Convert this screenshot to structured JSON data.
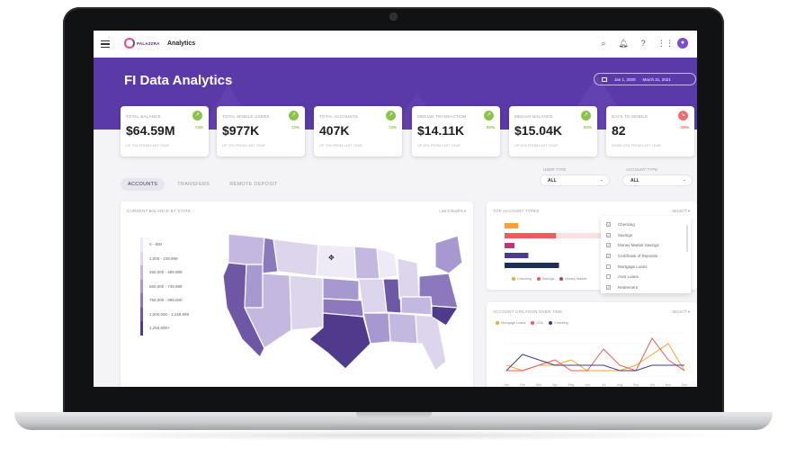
{
  "app": {
    "logo_text": "PALAZZRA",
    "title": "Analytics",
    "page_title": "FI Data Analytics",
    "date_start": "Jan 1, 2020",
    "date_end": "March 31, 2021"
  },
  "kpis": [
    {
      "label": "TOTAL BALANCE",
      "value": "$64.59M",
      "pct": "73%",
      "sub": "UP 73% FROM LAST YEAR",
      "trend": "up",
      "color": "#8bc34a"
    },
    {
      "label": "TOTAL MOBILE USERS",
      "value": "$977K",
      "pct": "72%",
      "sub": "UP 72% FROM LAST YEAR",
      "trend": "up",
      "color": "#8bc34a"
    },
    {
      "label": "TOTAL ACCOUNTS",
      "value": "407K",
      "pct": "72%",
      "sub": "UP 72% FROM LAST YEAR",
      "trend": "up",
      "color": "#8bc34a"
    },
    {
      "label": "MEDIAN TRANSACTION",
      "value": "$14.11K",
      "pct": "82%",
      "sub": "UP 82% FROM LAST YEAR",
      "trend": "up",
      "color": "#8bc34a"
    },
    {
      "label": "MEDIAN BALANCE",
      "value": "$15.04K",
      "pct": "92%",
      "sub": "UP 92% FROM LAST YEAR",
      "trend": "up",
      "color": "#8bc34a"
    },
    {
      "label": "DAYS TO MOBILE",
      "value": "82",
      "pct": "-25%",
      "sub": "DOWN 25% FROM LAST YEAR",
      "trend": "down",
      "color": "#f06b6b"
    }
  ],
  "tabs": [
    {
      "label": "ACCOUNTS",
      "active": true
    },
    {
      "label": "TRANSFERS",
      "active": false
    },
    {
      "label": "REMOTE DEPOSIT",
      "active": false
    }
  ],
  "filters": {
    "user_type_label": "USER TYPE",
    "user_type_value": "ALL",
    "account_type_label": "ACCOUNT TYPE",
    "account_type_value": "ALL"
  },
  "map_panel": {
    "title": "CURRENT BALANCE BY STATE",
    "action": "Last 6 Months",
    "legend": [
      {
        "label": "0 - 900",
        "color": "#eeeaf6"
      },
      {
        "label": "1,000 - 249,999",
        "color": "#dcd5ec"
      },
      {
        "label": "250,000 - 499,999",
        "color": "#c4b8e0"
      },
      {
        "label": "500,000 - 749,999",
        "color": "#a898d0"
      },
      {
        "label": "750,000 - 999,000",
        "color": "#8c79bd"
      },
      {
        "label": "1,000,000 - 1,249,999",
        "color": "#6e58a6"
      },
      {
        "label": "1,250,000+",
        "color": "#4f3a8c"
      }
    ]
  },
  "top_accounts_panel": {
    "title": "TOP ACCOUNT TYPES",
    "action": "SELECT",
    "bars": [
      {
        "name": "Checking",
        "value": 0.14,
        "color": "#f4a52a"
      },
      {
        "name": "Savings",
        "value": 0.52,
        "color": "#f05a5a"
      },
      {
        "name": "Money Market Savings",
        "value": 0.1,
        "color": "#c2357a"
      },
      {
        "name": "Certificate of Deposits",
        "value": 0.24,
        "color": "#4b3a8f"
      },
      {
        "name": "Retirement",
        "value": 0.55,
        "color": "#1f2f4f"
      }
    ],
    "legend": [
      "Checking",
      "Savings",
      "Money Market"
    ]
  },
  "account_type_dropdown": {
    "items": [
      {
        "label": "Checking",
        "checked": true
      },
      {
        "label": "Savings",
        "checked": true
      },
      {
        "label": "Money Market Savings",
        "checked": true
      },
      {
        "label": "Certificate of Deposits",
        "checked": true
      },
      {
        "label": "Mortgage Loans",
        "checked": false
      },
      {
        "label": "Auto Loans",
        "checked": false
      },
      {
        "label": "Retirement",
        "checked": true
      }
    ]
  },
  "creation_panel": {
    "title": "ACCOUNT CREATION OVER TIME",
    "action": "SELECT",
    "legend": [
      {
        "name": "Mortgage Loans",
        "color": "#f4a52a"
      },
      {
        "name": "CDs",
        "color": "#f05a5a"
      },
      {
        "name": "Checking",
        "color": "#3b3d8f"
      }
    ]
  },
  "chart_data": {
    "type": "line",
    "title": "ACCOUNT CREATION OVER TIME",
    "x": [
      "Jan",
      "Feb",
      "Mar",
      "Apr",
      "May",
      "Jun",
      "Jul",
      "Aug",
      "Sep",
      "Oct",
      "Nov",
      "Dec"
    ],
    "series": [
      {
        "name": "Mortgage Loans",
        "values": [
          2,
          1,
          2,
          2,
          3,
          1,
          1,
          1,
          2,
          4,
          6,
          1
        ]
      },
      {
        "name": "CDs",
        "values": [
          1,
          1,
          2,
          3,
          1,
          1,
          5,
          2,
          1,
          7,
          3,
          1
        ]
      },
      {
        "name": "Checking",
        "values": [
          1,
          4,
          3,
          2,
          2,
          2,
          2,
          1,
          1,
          2,
          2,
          2
        ]
      }
    ]
  }
}
